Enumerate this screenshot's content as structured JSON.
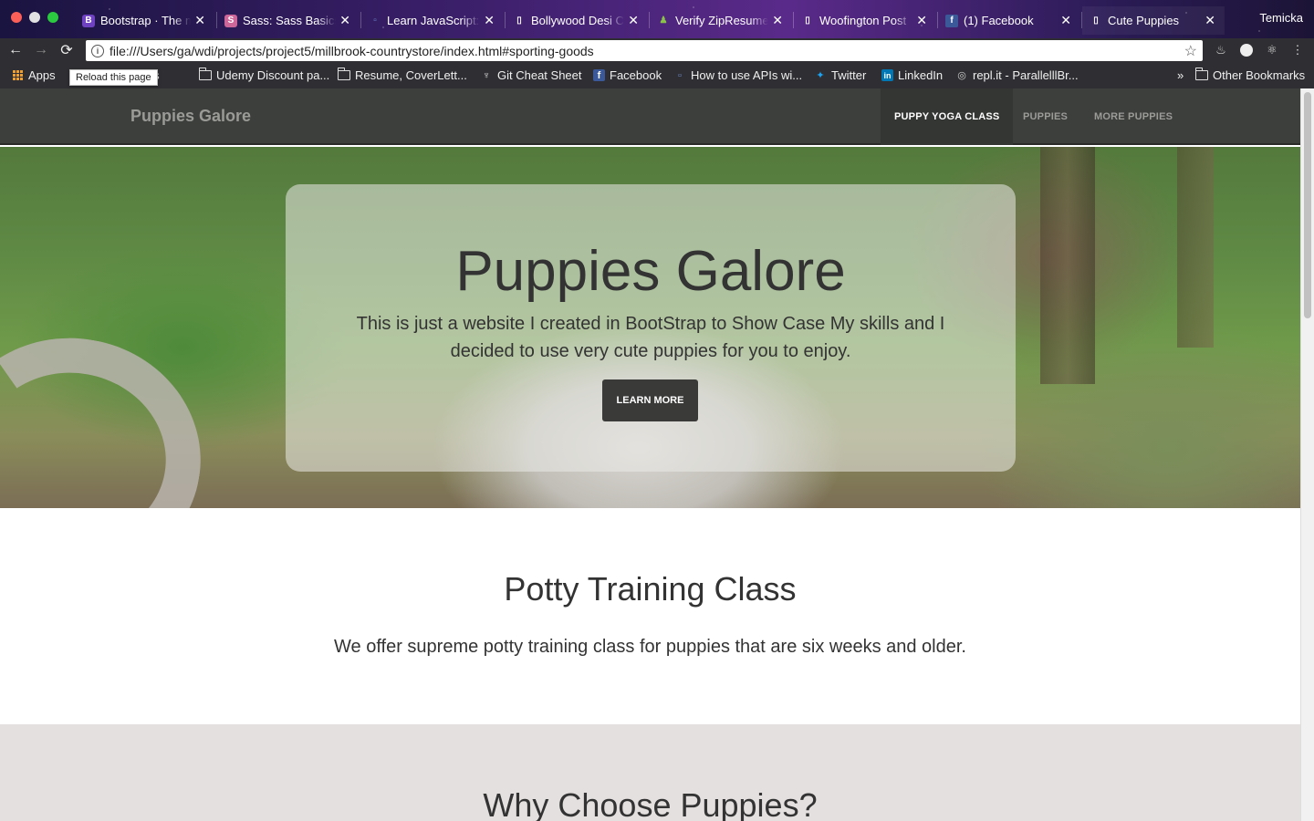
{
  "browser": {
    "profile_name": "Temicka",
    "tabs": [
      {
        "title": "Bootstrap · The most popular",
        "favicon": "B",
        "favicon_color": "#6f42c1",
        "active": false
      },
      {
        "title": "Sass: Sass Basics",
        "favicon": "S",
        "favicon_color": "#cd6799",
        "active": false
      },
      {
        "title": "Learn JavaScript:",
        "favicon": "▫",
        "favicon_color": "#3b5998",
        "active": false
      },
      {
        "title": "Bollywood Desi Cl",
        "favicon": "▯",
        "favicon_color": "#ffffff",
        "active": false
      },
      {
        "title": "Verify ZipResume",
        "favicon": "♟",
        "favicon_color": "#8bc34a",
        "active": false
      },
      {
        "title": "Woofington Post",
        "favicon": "▯",
        "favicon_color": "#ffffff",
        "active": false
      },
      {
        "title": "(1) Facebook",
        "favicon": "f",
        "favicon_color": "#3b5998",
        "active": false
      },
      {
        "title": "Cute Puppies",
        "favicon": "▯",
        "favicon_color": "#ffffff",
        "active": true
      }
    ],
    "address": "file:///Users/ga/wdi/projects/project5/millbrook-countrystore/index.html#sporting-goods",
    "tooltip": "Reload this page",
    "bookmarks": [
      {
        "label": "Apps",
        "icon": "apps-grid"
      },
      {
        "label": "utes",
        "icon": "folder"
      },
      {
        "label": "Udemy Discount pa...",
        "icon": "folder"
      },
      {
        "label": "Resume, CoverLett...",
        "icon": "folder"
      },
      {
        "label": "Git Cheat Sheet",
        "icon": "git"
      },
      {
        "label": "Facebook",
        "icon": "facebook"
      },
      {
        "label": "How to use APIs wi...",
        "icon": "page"
      },
      {
        "label": "Twitter",
        "icon": "twitter"
      },
      {
        "label": "LinkedIn",
        "icon": "linkedin"
      },
      {
        "label": "repl.it - ParallelllBr...",
        "icon": "replit"
      }
    ],
    "overflow_label": "»",
    "other_bookmarks": "Other Bookmarks"
  },
  "site": {
    "brand": "Puppies Galore",
    "nav": [
      {
        "label": "PUPPY YOGA CLASS",
        "active": true
      },
      {
        "label": "PUPPIES",
        "active": false
      },
      {
        "label": "MORE PUPPIES",
        "active": false
      }
    ],
    "hero": {
      "title": "Puppies Galore",
      "text": "This is just a website I created in BootStrap to Show Case My skills and I decided to use very cute puppies for you to enjoy.",
      "button": "LEARN MORE"
    },
    "potty": {
      "heading": "Potty Training Class",
      "text": "We offer supreme potty training class for puppies that are six weeks and older."
    },
    "why": {
      "heading": "Why Choose Puppies?"
    }
  }
}
